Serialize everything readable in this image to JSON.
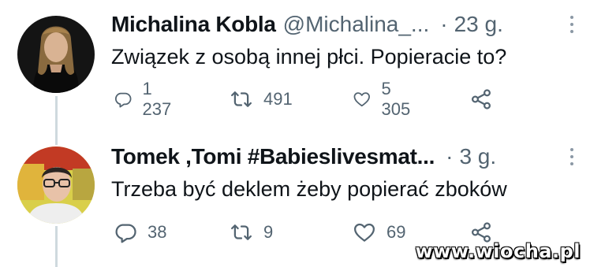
{
  "tweets": [
    {
      "display_name": "Michalina Kobla",
      "handle": "@Michalina_...",
      "separator": "·",
      "time": "23 g.",
      "text": "Związek z osobą innej płci. Popieracie to?",
      "replies": "1 237",
      "retweets": "491",
      "likes": "5 305"
    },
    {
      "display_name": "Tomek ,Tomi #Babieslivesmat...",
      "handle": "",
      "separator": "·",
      "time": "3 g.",
      "text": "Trzeba być deklem żeby popierać zboków",
      "replies": "38",
      "retweets": "9",
      "likes": "69"
    }
  ],
  "icons": {
    "reply": "reply-icon",
    "retweet": "retweet-icon",
    "like": "heart-icon",
    "share": "share-icon",
    "more": "more-vertical-icon"
  },
  "colors": {
    "text_primary": "#0f1419",
    "text_secondary": "#536471",
    "thread_line": "#cfd9de"
  },
  "watermark": "www.wiocha.pl"
}
